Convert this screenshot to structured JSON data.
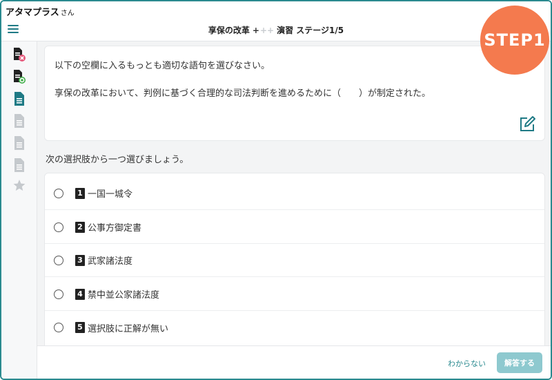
{
  "user": {
    "name": "アタマプラス",
    "suffix": "さん"
  },
  "header": {
    "title": "享保の改革",
    "plus_filled": "+",
    "plus_empty": "++",
    "mode": "演習",
    "stage": "ステージ1/5"
  },
  "badge": {
    "label": "STEP1",
    "color": "#f47a4e"
  },
  "sidebar": {
    "icons": [
      "doc-wrong-icon",
      "doc-correct-icon",
      "doc-current-icon",
      "doc-icon",
      "doc-icon",
      "doc-icon",
      "star-icon"
    ]
  },
  "question": {
    "instruction": "以下の空欄に入るもっとも適切な語句を選びなさい。",
    "text": "享保の改革において、判例に基づく合理的な司法判断を進めるために（　　）が制定された。"
  },
  "prompt": "次の選択肢から一つ選びましょう。",
  "choices": [
    {
      "num": "1",
      "label": "一国一城令"
    },
    {
      "num": "2",
      "label": "公事方御定書"
    },
    {
      "num": "3",
      "label": "武家諸法度"
    },
    {
      "num": "4",
      "label": "禁中並公家諸法度"
    },
    {
      "num": "5",
      "label": "選択肢に正解が無い"
    }
  ],
  "footer": {
    "dunno": "わからない",
    "submit": "解答する"
  },
  "colors": {
    "accent": "#2a8a8f",
    "submit_disabled": "#8ec9cf"
  }
}
